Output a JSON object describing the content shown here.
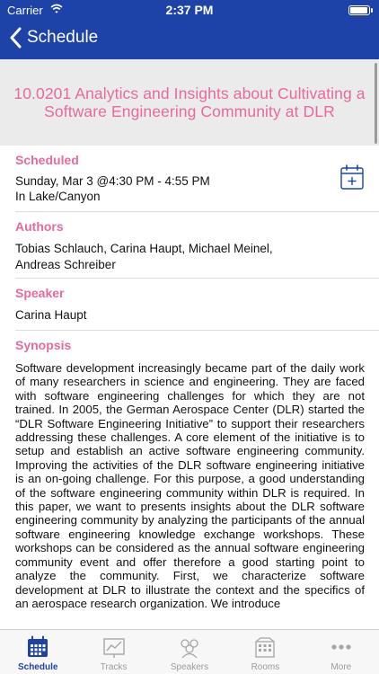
{
  "status": {
    "carrier": "Carrier",
    "time": "2:37 PM",
    "battery_level": 0.95
  },
  "nav": {
    "back_label": "Schedule"
  },
  "session": {
    "title": "10.0201 Analytics and Insights about Cultivating a Software Engineering Community at DLR"
  },
  "scheduled": {
    "heading": "Scheduled",
    "time": "Sunday, Mar 3 @4:30 PM - 4:55 PM",
    "room": "In Lake/Canyon"
  },
  "authors": {
    "heading": "Authors",
    "names": "Tobias Schlauch, Carina Haupt, Michael Meinel, Andreas Schreiber"
  },
  "speaker": {
    "heading": "Speaker",
    "name": "Carina Haupt"
  },
  "synopsis": {
    "heading": "Synopsis",
    "text": "Software development increasingly became part of the daily work of many researchers in science and engineering. They are faced with software engineering challenges for which they are not trained. In 2005, the German Aerospace Center (DLR) started the “DLR Software Engineering Initiative” to support their researchers addressing these challenges. A core element of the initiative is to setup and establish an active software engineering community. Improving the activities of the DLR software engineering initiative is an on-going challenge. For this purpose, a good understanding of the software engineering community within DLR is required. In this paper, we want to presents insights about the DLR software engineering community by analyzing the participants of the annual software engineering knowledge exchange workshops. These workshops can be considered as the annual software engineering community event and offer therefore a good starting point to analyze the community. First, we characterize software development at DLR to illustrate the context and the specifics of an aerospace research organization. We introduce"
  },
  "tabs": [
    {
      "label": "Schedule",
      "icon": "calendar-icon",
      "active": true
    },
    {
      "label": "Tracks",
      "icon": "tracks-icon",
      "active": false
    },
    {
      "label": "Speakers",
      "icon": "speakers-icon",
      "active": false
    },
    {
      "label": "Rooms",
      "icon": "rooms-icon",
      "active": false
    },
    {
      "label": "More",
      "icon": "more-icon",
      "active": false
    }
  ],
  "colors": {
    "nav": "#1d43a8",
    "accent": "#e56aa0",
    "title_band": "#ebebeb"
  }
}
